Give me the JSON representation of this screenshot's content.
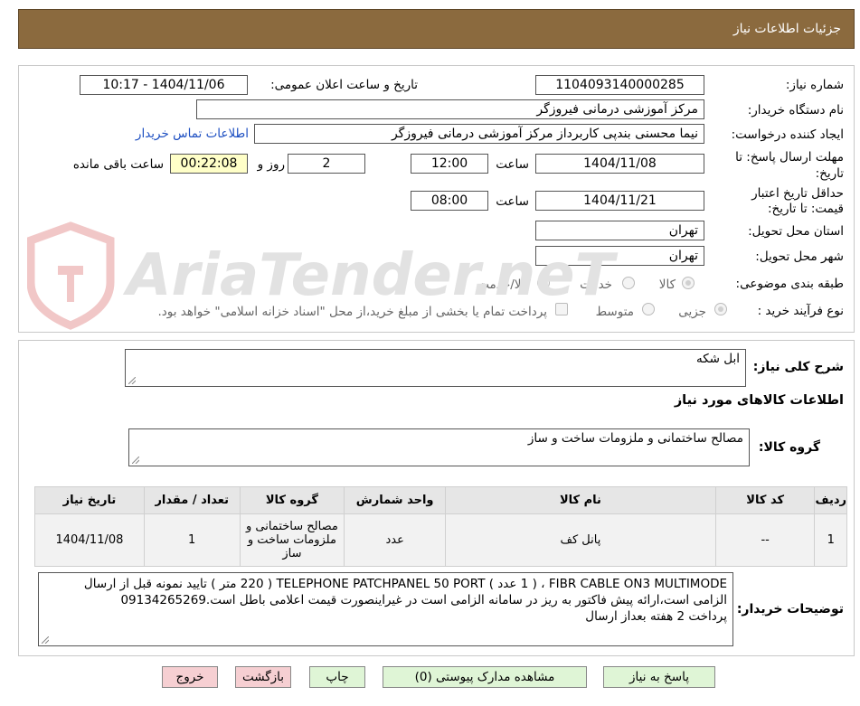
{
  "header": {
    "title": "جزئیات اطلاعات نیاز"
  },
  "form": {
    "need_number_label": "شماره نیاز:",
    "need_number": "1104093140000285",
    "announce_label": "تاریخ و ساعت اعلان عمومی:",
    "announce_value": "1404/11/06 - 10:17",
    "buyer_org_label": "نام دستگاه خریدار:",
    "buyer_org": "مرکز آموزشی درمانی فیروزگر",
    "creator_label": "ایجاد کننده درخواست:",
    "creator": "نیما محسنی بندپی کاربرداز مرکز آموزشی درمانی فیروزگر",
    "contact_link": "اطلاعات تماس خریدار",
    "deadline_label_1": "مهلت ارسال پاسخ: تا",
    "deadline_label_2": "تاریخ:",
    "deadline_date": "1404/11/08",
    "time_label": "ساعت",
    "deadline_time": "12:00",
    "days_value": "2",
    "days_label": "روز و",
    "remaining_value": "00:22:08",
    "remaining_label": "ساعت باقی مانده",
    "validity_label_1": "حداقل تاریخ اعتبار",
    "validity_label_2": "قیمت: تا تاریخ:",
    "validity_date": "1404/11/21",
    "validity_time": "08:00",
    "province_label": "استان محل تحویل:",
    "province": "تهران",
    "city_label": "شهر محل تحویل:",
    "city": "تهران",
    "category_label": "طبقه بندی موضوعی:",
    "category_options": [
      "کالا",
      "خدمت",
      "کالا/خدمت"
    ],
    "process_label": "نوع فرآیند خرید :",
    "process_options": [
      "جزیی",
      "متوسط"
    ],
    "treasury_note": "پرداخت تمام یا بخشی از مبلغ خرید،از محل \"اسناد خزانه اسلامی\" خواهد بود."
  },
  "details": {
    "summary_label": "شرح کلی نیاز:",
    "summary_value": "ابل شکه",
    "goods_info_title": "اطلاعات کالاهای مورد نیاز",
    "goods_group_label": "گروه کالا:",
    "goods_group_value": "مصالح ساختمانی و ملزومات ساخت و ساز"
  },
  "table": {
    "headers": [
      "ردیف",
      "کد کالا",
      "نام کالا",
      "واحد شمارش",
      "گروه کالا",
      "تعداد / مقدار",
      "تاریخ نیاز"
    ],
    "rows": [
      [
        "1",
        "--",
        "پانل کف",
        "عدد",
        "مصالح ساختمانی و ملزومات ساخت و ساز",
        "1",
        "1404/11/08"
      ]
    ]
  },
  "buyer_notes": {
    "label": "توضیحات خریدار:",
    "line1": "FIBR CABLE ON3 MULTIMODE ، ( 1 عدد ) TELEPHONE PATCHPANEL 50 PORT ( 220 متر ) تایید نمونه قبل از ارسال",
    "line2": "الزامی است،ارائه پیش فاکتور به ریز در سامانه الزامی است در غیراینصورت قیمت اعلامی باطل است.09134265269",
    "line3": "پرداخت 2 هفته بعداز ارسال"
  },
  "buttons": {
    "reply": "پاسخ به نیاز",
    "attachments": "مشاهده مدارک پیوستی (0)",
    "print": "چاپ",
    "back": "بازگشت",
    "exit": "خروج"
  },
  "colors": {
    "header_bg": "#8b6a3e",
    "link": "#1d4fc2",
    "remaining_bg": "#ffffc8",
    "green_button": "#dff5d6",
    "pink_button": "#f6cfd2"
  },
  "watermark": {
    "text": "AriaTender.neT"
  }
}
